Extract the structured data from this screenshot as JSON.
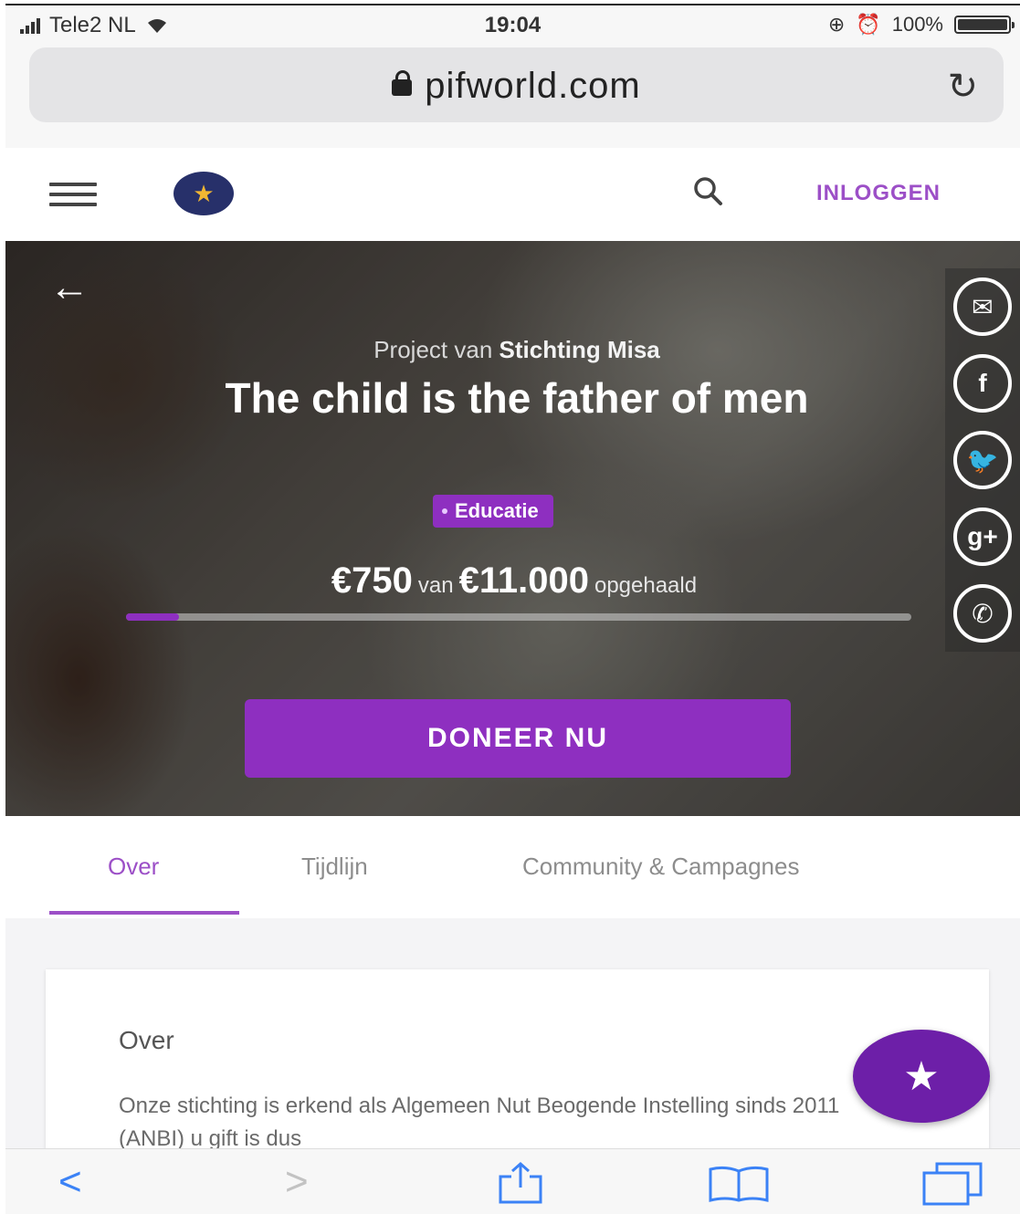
{
  "status_bar": {
    "carrier": "Tele2 NL",
    "wifi_icon": "wifi-icon",
    "time": "19:04",
    "battery_percent": "100%",
    "battery_level": 1.0
  },
  "browser": {
    "url": "pifworld.com",
    "reload_icon": "reload-icon"
  },
  "nav": {
    "login_label": "INLOGGEN"
  },
  "hero": {
    "byline_prefix": "Project van",
    "byline_org": "Stichting Misa",
    "title": "The child is the father of men",
    "tag": "Educatie",
    "raised_amount": "€750",
    "raised_van": "van",
    "goal_amount": "€11.000",
    "raised_suffix": "opgehaald",
    "progress_fraction": 0.068,
    "donate_label": "DONEER NU",
    "share_icons": [
      "email-icon",
      "facebook-icon",
      "twitter-icon",
      "google-plus-icon",
      "whatsapp-icon"
    ]
  },
  "tabs": [
    {
      "label": "Over",
      "active": true
    },
    {
      "label": "Tijdlijn",
      "active": false
    },
    {
      "label": "Community & Campagnes",
      "active": false
    }
  ],
  "content": {
    "heading": "Over",
    "body": "Onze stichting is erkend als Algemeen Nut Beogende Instelling sinds 2011 (ANBI) u gift is dus"
  },
  "colors": {
    "brand_purple": "#8e2fc0",
    "link_purple": "#9c4fc7",
    "fab_purple": "#6d1fa8",
    "ios_blue": "#3b82f6"
  }
}
